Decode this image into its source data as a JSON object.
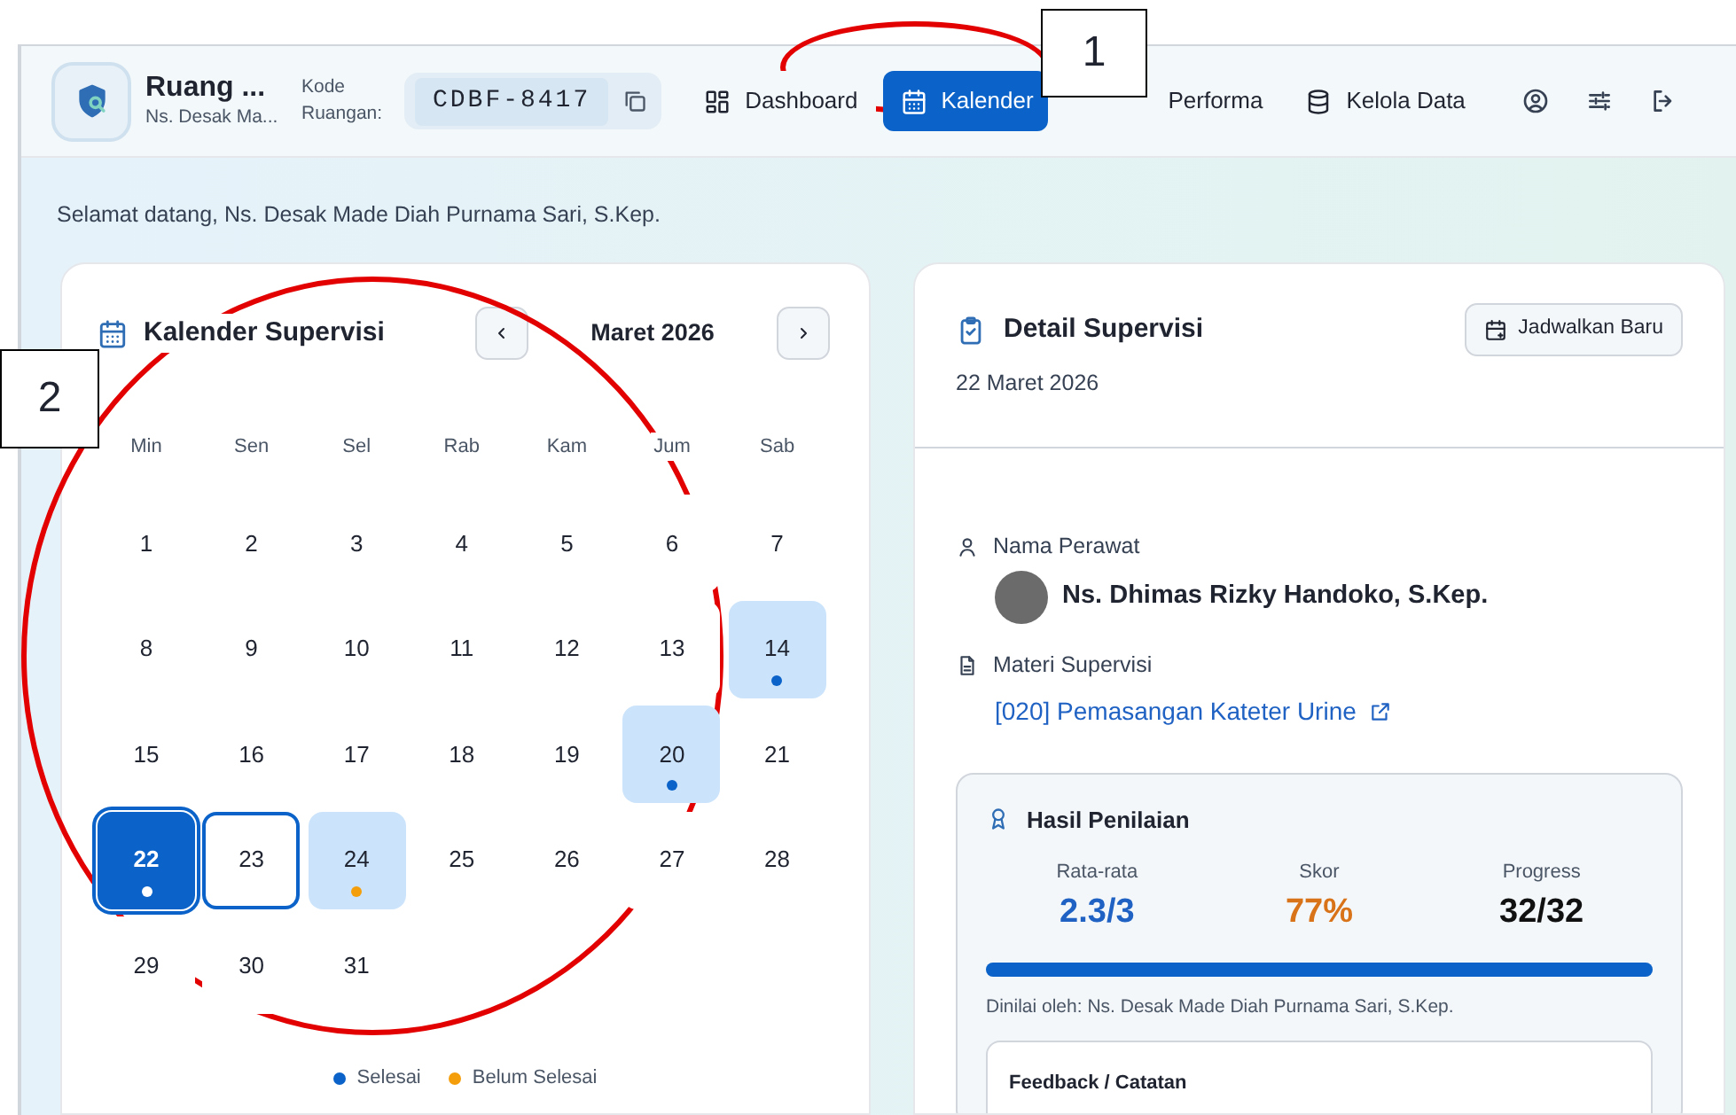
{
  "header": {
    "room_title": "Ruang ...",
    "room_user": "Ns. Desak Ma...",
    "code_label": "Kode Ruangan:",
    "code": "CDBF-8417",
    "nav": [
      {
        "label": "Dashboard",
        "selected": false
      },
      {
        "label": "Kalender",
        "selected": true
      },
      {
        "label": "Performa",
        "selected": false
      },
      {
        "label": "Kelola Data",
        "selected": false
      }
    ]
  },
  "welcome": "Selamat datang, Ns. Desak Made Diah Purnama Sari, S.Kep.",
  "calendar": {
    "title": "Kalender Supervisi",
    "month": "Maret 2026",
    "weekdays": [
      "Min",
      "Sen",
      "Sel",
      "Rab",
      "Kam",
      "Jum",
      "Sab"
    ],
    "days": [
      {
        "label": "1"
      },
      {
        "label": "2"
      },
      {
        "label": "3"
      },
      {
        "label": "4"
      },
      {
        "label": "5"
      },
      {
        "label": "6"
      },
      {
        "label": "7"
      },
      {
        "label": "8"
      },
      {
        "label": "9"
      },
      {
        "label": "10"
      },
      {
        "label": "11"
      },
      {
        "label": "12"
      },
      {
        "label": "13"
      },
      {
        "label": "14",
        "kind": "done"
      },
      {
        "label": "15"
      },
      {
        "label": "16"
      },
      {
        "label": "17"
      },
      {
        "label": "18"
      },
      {
        "label": "19"
      },
      {
        "label": "20",
        "kind": "done"
      },
      {
        "label": "21"
      },
      {
        "label": "22",
        "kind": "done",
        "selected": true
      },
      {
        "label": "23",
        "today": true
      },
      {
        "label": "24",
        "kind": "pending"
      },
      {
        "label": "25"
      },
      {
        "label": "26"
      },
      {
        "label": "27"
      },
      {
        "label": "28"
      },
      {
        "label": "29"
      },
      {
        "label": "30"
      },
      {
        "label": "31"
      }
    ],
    "legend": [
      {
        "label": "Selesai",
        "color": "#0b63c9"
      },
      {
        "label": "Belum Selesai",
        "color": "#f59e0b"
      }
    ]
  },
  "detail": {
    "title": "Detail Supervisi",
    "date": "22 Maret 2026",
    "new_button": "Jadwalkan Baru",
    "nurse_label": "Nama Perawat",
    "nurse": "Ns. Dhimas Rizky Handoko, S.Kep.",
    "material_label": "Materi Supervisi",
    "material": "[020] Pemasangan Kateter Urine",
    "result": {
      "title": "Hasil Penilaian",
      "stats": [
        {
          "label": "Rata-rata",
          "value": "2.3/3",
          "kind": "average"
        },
        {
          "label": "Skor",
          "value": "77%",
          "kind": "score"
        },
        {
          "label": "Progress",
          "value": "32/32",
          "kind": "progress"
        }
      ],
      "level": 1,
      "assessor": "Dinilai oleh: Ns. Desak Made Diah Purnama Sari, S.Kep.",
      "feedback_title": "Feedback / Catatan"
    }
  },
  "annotations": [
    {
      "label": "1"
    },
    {
      "label": "2"
    }
  ]
}
